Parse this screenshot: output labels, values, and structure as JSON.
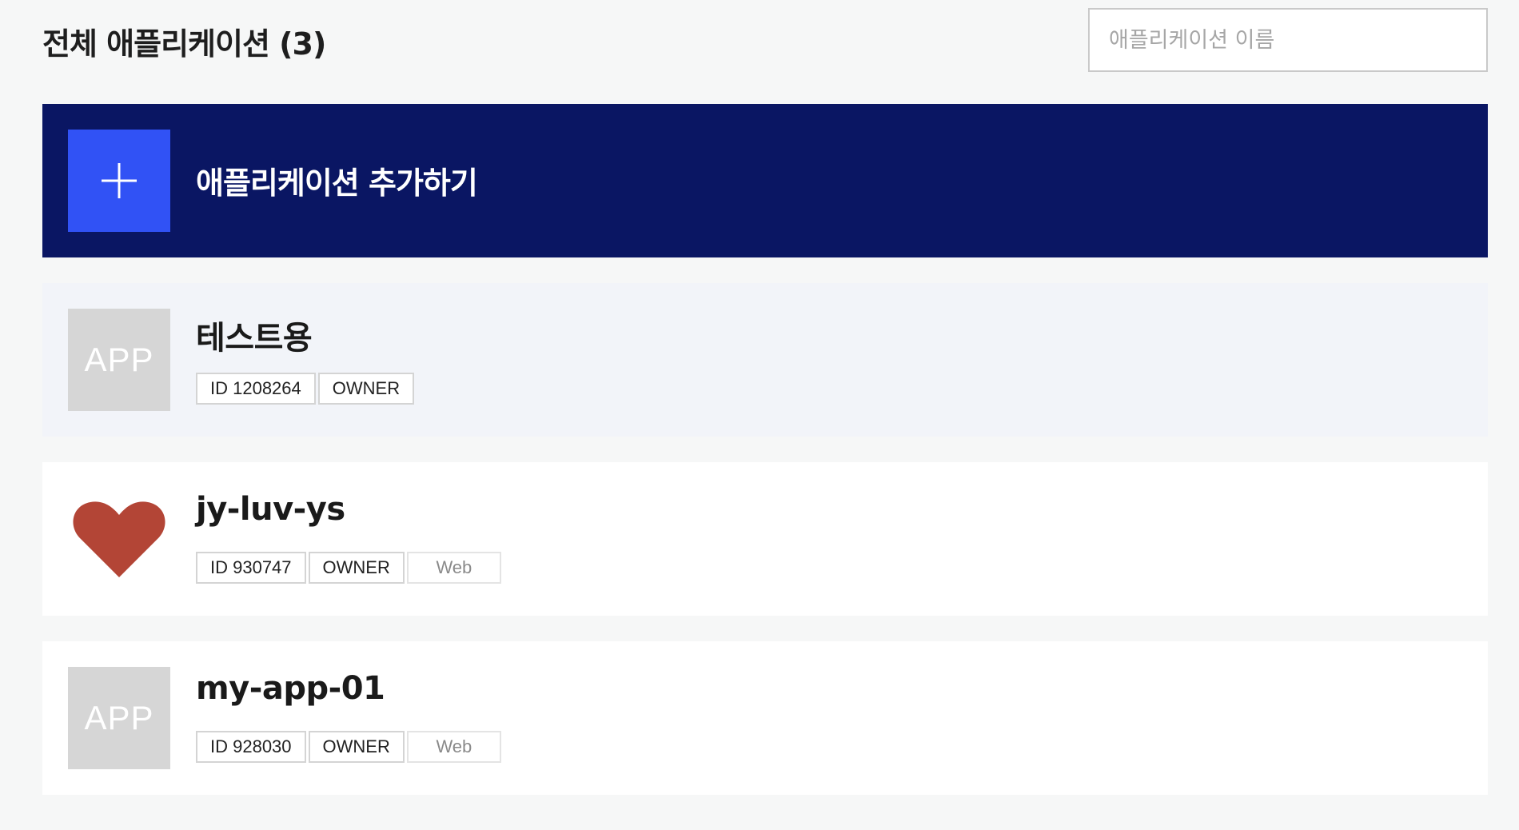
{
  "header": {
    "title": "전체 애플리케이션 (3)",
    "search_placeholder": "애플리케이션 이름"
  },
  "add_app": {
    "label": "애플리케이션 추가하기",
    "icon": "plus-icon"
  },
  "apps": [
    {
      "name": "테스트용",
      "thumb_text": "APP",
      "thumb_type": "placeholder",
      "id_label": "ID 1208264",
      "role": "OWNER",
      "platform": ""
    },
    {
      "name": "jy-luv-ys",
      "thumb_text": "",
      "thumb_type": "heart-icon",
      "id_label": "ID 930747",
      "role": "OWNER",
      "platform": "Web"
    },
    {
      "name": "my-app-01",
      "thumb_text": "APP",
      "thumb_type": "placeholder",
      "id_label": "ID 928030",
      "role": "OWNER",
      "platform": "Web"
    }
  ],
  "colors": {
    "page_bg": "#f6f7f7",
    "add_card_bg": "#0a1663",
    "add_icon_bg": "#3152f5",
    "heart": "#b34536",
    "placeholder_thumb": "#d6d6d6"
  }
}
